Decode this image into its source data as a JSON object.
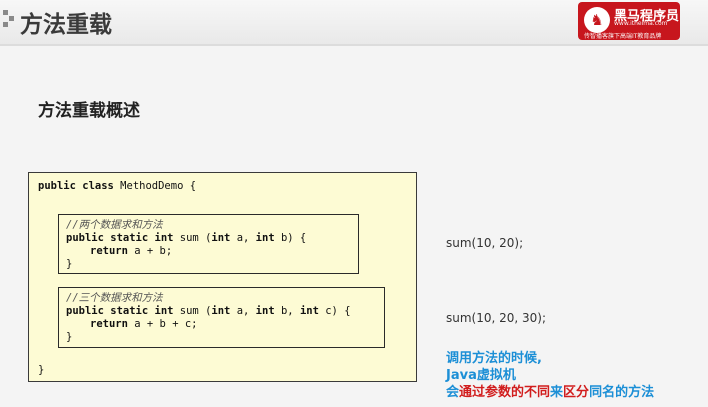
{
  "header": {
    "title": "方法重载"
  },
  "logo": {
    "name": "黑马程序员",
    "url": "www.itheima.com",
    "slogan": "传智播客旗下高端IT教育品牌",
    "color": "#c7161d"
  },
  "section": {
    "heading": "方法重载概述"
  },
  "code": {
    "class_line_kw": "public class",
    "class_line_rest": " MethodDemo {",
    "method1": {
      "comment": "//两个数据求和方法",
      "sig_kw1": "public static int",
      "sig_rest1": " sum (",
      "sig_kw2": "int",
      "sig_rest2": " a, ",
      "sig_kw3": "int",
      "sig_rest3": " b) {",
      "ret_kw": "return",
      "ret_rest": " a + b;",
      "close": "}"
    },
    "method2": {
      "comment": "//三个数据求和方法",
      "sig_kw1": "public static int",
      "sig_rest1": " sum (",
      "sig_kw2": "int",
      "sig_rest2": " a, ",
      "sig_kw3": "int",
      "sig_rest3": " b, ",
      "sig_kw4": "int",
      "sig_rest4": " c) {",
      "ret_kw": "return",
      "ret_rest": " a + b + c;",
      "close": "}"
    },
    "class_close": "}"
  },
  "calls": {
    "call1": "sum(10, 20);",
    "call2": "sum(10, 20, 30);"
  },
  "note": {
    "line1": "调用方法的时候,",
    "line2": "Java虚拟机",
    "line3_a": "会",
    "line3_b": "通过参数的不同",
    "line3_c": "来",
    "line3_d": "区分",
    "line3_e": "同名的方法",
    "colors": {
      "blue": "#1c8fd6",
      "red": "#d11d1d"
    }
  }
}
